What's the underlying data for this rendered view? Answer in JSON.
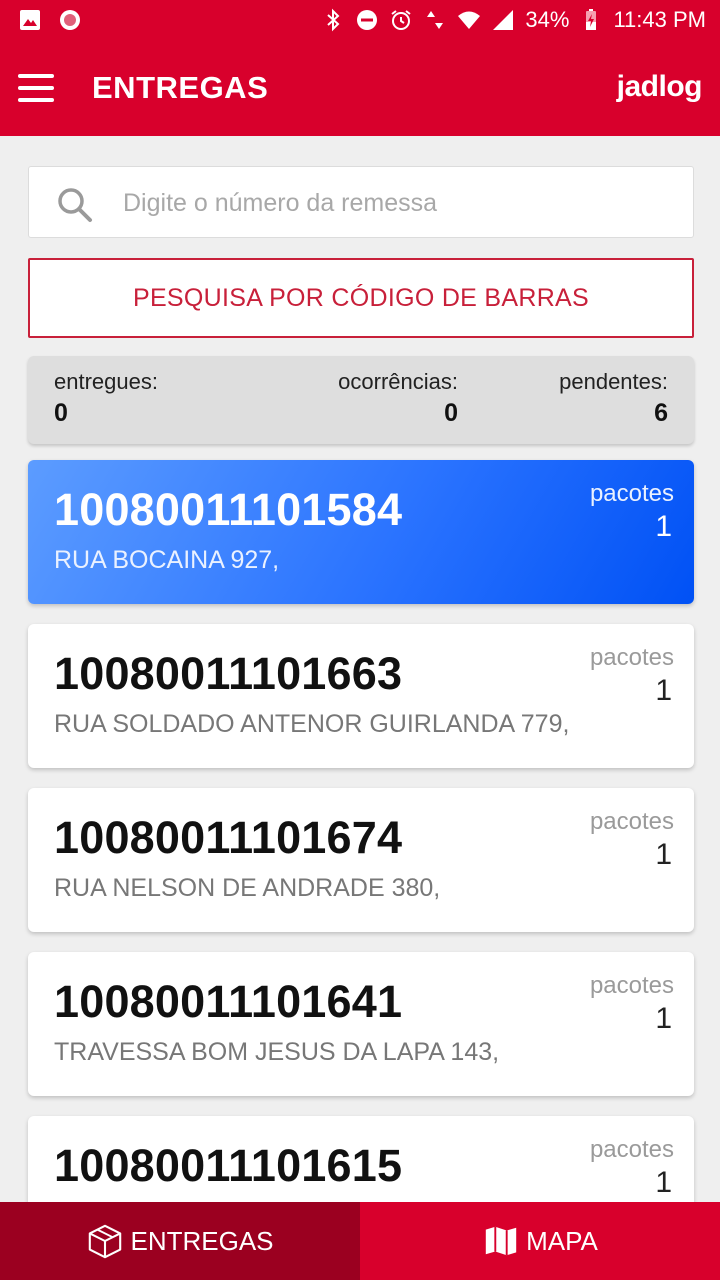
{
  "status_bar": {
    "battery": "34%",
    "time": "11:43 PM"
  },
  "app_bar": {
    "title": "ENTREGAS",
    "brand": "jadlog"
  },
  "search": {
    "placeholder": "Digite o número da remessa"
  },
  "barcode_button": {
    "label": "PESQUISA POR CÓDIGO DE BARRAS"
  },
  "summary": {
    "delivered_label": "entregues:",
    "delivered_value": "0",
    "occurrences_label": "ocorrências:",
    "occurrences_value": "0",
    "pending_label": "pendentes:",
    "pending_value": "6"
  },
  "deliveries": [
    {
      "code": "10080011101584",
      "address": "RUA BOCAINA 927,",
      "packages_label": "pacotes",
      "packages": "1"
    },
    {
      "code": "10080011101663",
      "address": "RUA SOLDADO ANTENOR GUIRLANDA 779,",
      "packages_label": "pacotes",
      "packages": "1"
    },
    {
      "code": "10080011101674",
      "address": "RUA NELSON DE ANDRADE 380,",
      "packages_label": "pacotes",
      "packages": "1"
    },
    {
      "code": "10080011101641",
      "address": "TRAVESSA BOM JESUS DA LAPA 143,",
      "packages_label": "pacotes",
      "packages": "1"
    },
    {
      "code": "10080011101615",
      "address": "",
      "packages_label": "pacotes",
      "packages": "1"
    }
  ],
  "bottom_nav": {
    "deliveries_label": "ENTREGAS",
    "map_label": "MAPA"
  },
  "colors": {
    "primary_red": "#d8002c",
    "selected_tab": "#9b0020",
    "active_card_blue": "#2a73ff"
  }
}
